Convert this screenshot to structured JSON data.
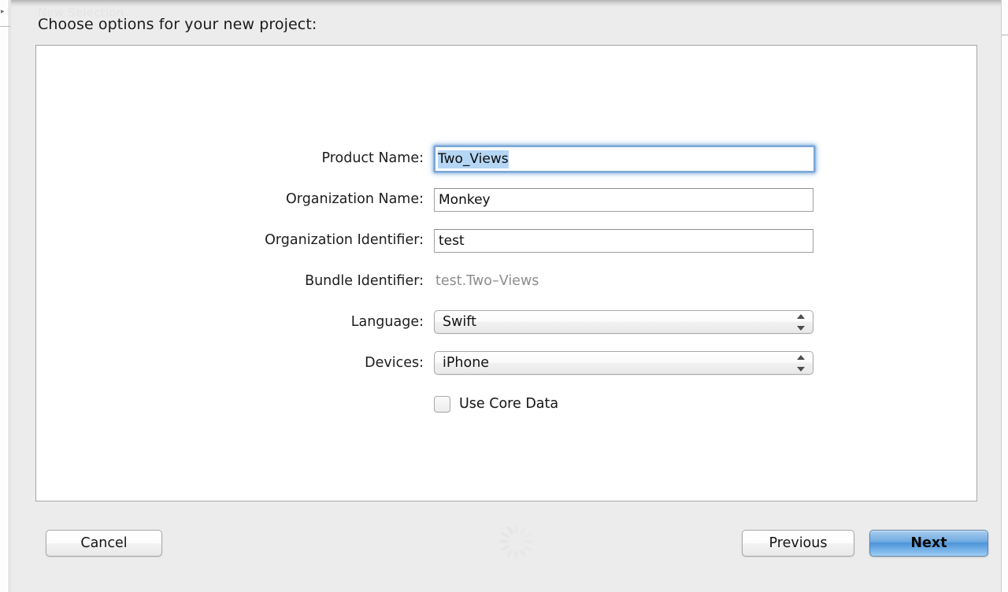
{
  "window": {
    "background_ghost_text": "New Selection",
    "sheet_title": "Choose options for your new project:"
  },
  "form": {
    "rows": [
      {
        "label": "Product Name:",
        "value": "Two_Views",
        "type": "text-field",
        "focused": true,
        "selected": true
      },
      {
        "label": "Organization Name:",
        "value": "Monkey",
        "type": "text-field",
        "focused": false,
        "selected": false
      },
      {
        "label": "Organization Identifier:",
        "value": "test",
        "type": "text-field",
        "focused": false,
        "selected": false
      },
      {
        "label": "Bundle Identifier:",
        "value": "test.Two–Views",
        "type": "static-text",
        "focused": false,
        "selected": false
      },
      {
        "label": "Language:",
        "value": "Swift",
        "type": "popup-button",
        "focused": false,
        "selected": false
      },
      {
        "label": "Devices:",
        "value": "iPhone",
        "type": "popup-button",
        "focused": false,
        "selected": false
      }
    ],
    "checkbox": {
      "label": "Use Core Data",
      "checked": false
    }
  },
  "footer": {
    "cancel_label": "Cancel",
    "previous_label": "Previous",
    "next_label": "Next"
  },
  "colors": {
    "sheet_background": "#ececec",
    "panel_background": "#ffffff",
    "focus_ring": "#7aa7d4",
    "selection_highlight": "#b5d6f4",
    "default_button": "#4e95da",
    "disabled_text": "#8d8d8d",
    "label_text": "#1c1c1c"
  }
}
